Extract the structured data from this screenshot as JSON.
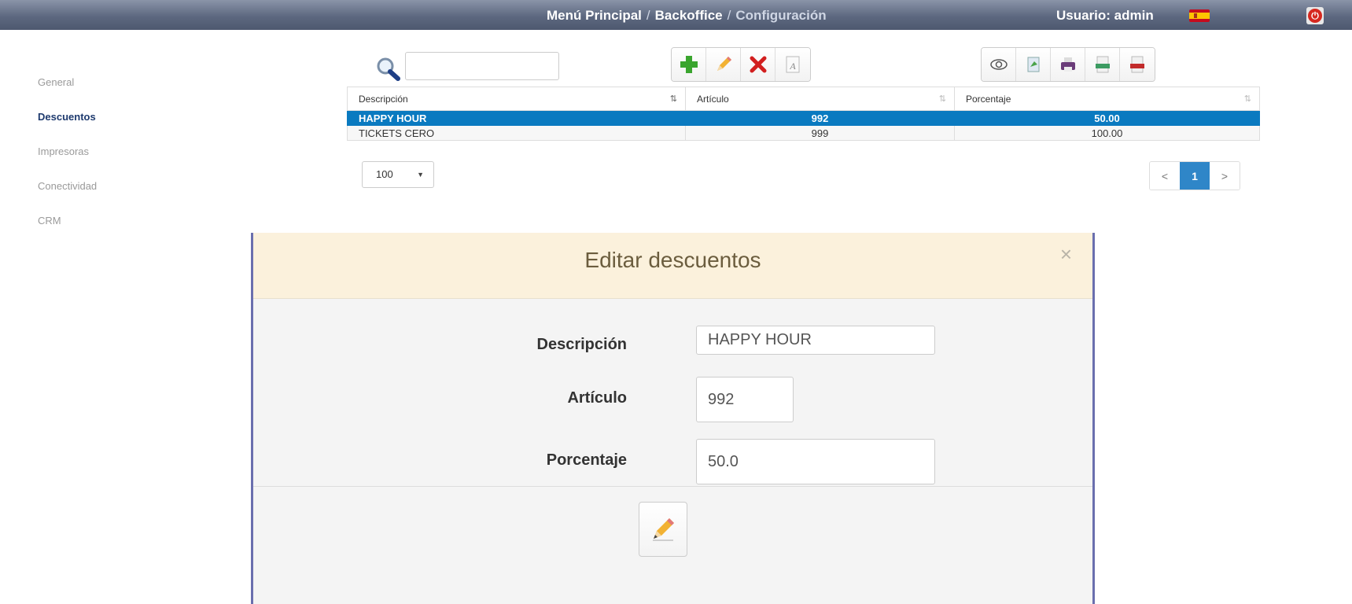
{
  "header": {
    "breadcrumb": [
      "Menú Principal",
      "Backoffice",
      "Configuración"
    ],
    "separator": "/",
    "user_label": "Usuario: admin",
    "flag_icon": "spain-flag-icon",
    "power_icon": "power-icon",
    "power_glyph": "⏻"
  },
  "sidebar": {
    "items": [
      {
        "label": "General",
        "active": false
      },
      {
        "label": "Descuentos",
        "active": true
      },
      {
        "label": "Impresoras",
        "active": false
      },
      {
        "label": "Conectividad",
        "active": false
      },
      {
        "label": "CRM",
        "active": false
      }
    ]
  },
  "search": {
    "value": "",
    "placeholder": ""
  },
  "toolbar": {
    "edit_tools": [
      "add-icon",
      "edit-pencil-icon",
      "delete-icon",
      "font-icon"
    ],
    "export_tools": [
      "view-eye-icon",
      "export-icon",
      "print-icon",
      "csv-icon",
      "pdf-icon"
    ]
  },
  "table": {
    "columns": [
      "Descripción",
      "Artículo",
      "Porcentaje"
    ],
    "rows": [
      {
        "descripcion": "HAPPY HOUR",
        "articulo": "992",
        "porcentaje": "50.00",
        "selected": true
      },
      {
        "descripcion": "TICKETS CERO",
        "articulo": "999",
        "porcentaje": "100.00",
        "selected": false
      }
    ]
  },
  "page_size": {
    "value": "100"
  },
  "pagination": {
    "prev": "<",
    "current": "1",
    "next": ">"
  },
  "modal": {
    "title": "Editar descuentos",
    "close": "×",
    "fields": {
      "descripcion": {
        "label": "Descripción",
        "value": "HAPPY HOUR"
      },
      "articulo": {
        "label": "Artículo",
        "value": "992"
      },
      "porcentaje": {
        "label": "Porcentaje",
        "value": "50.0"
      }
    },
    "save_icon": "edit-pencil-icon"
  },
  "colors": {
    "topbar": "#5d6880",
    "selected_row": "#0a7ac0",
    "modal_header": "#fbf1dc",
    "modal_border": "#6a6fae",
    "pager_current": "#2f86c8"
  }
}
